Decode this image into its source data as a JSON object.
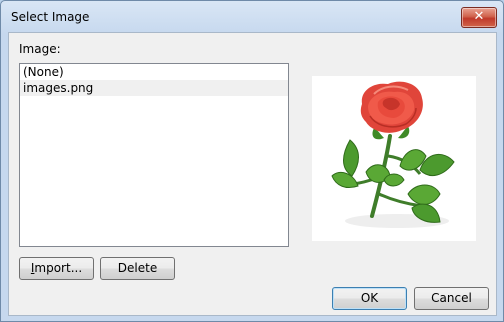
{
  "window": {
    "title": "Select Image",
    "close_glyph": "✕"
  },
  "image_label": "Image:",
  "list": {
    "items": [
      {
        "label": "(None)",
        "selected": false
      },
      {
        "label": "images.png",
        "selected": true
      }
    ]
  },
  "preview": {
    "description_icon": "rose-image"
  },
  "buttons": {
    "import_pre": "I",
    "import_rest": "mport...",
    "delete": "Delete",
    "ok": "OK",
    "cancel": "Cancel"
  }
}
